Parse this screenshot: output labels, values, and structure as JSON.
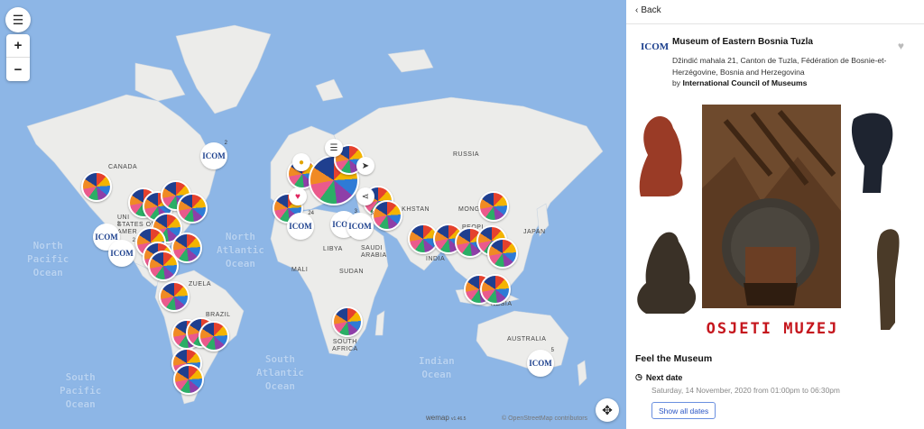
{
  "map": {
    "menu_icon": "hamburger-icon",
    "zoom_in": "+",
    "zoom_out": "−",
    "locate_icon": "crosshair-icon",
    "wemap_brand": "wemap",
    "wemap_version": "v1.46.5",
    "attribution": "© OpenStreetMap contributors",
    "place_labels": {
      "canada": "CANADA",
      "united_states": "UNI\nSTATES OF\nAMER",
      "russia": "RUSSIA",
      "mongolia": "MONGO",
      "kazakhstan": "AKHSTAN",
      "people": "PEOPL",
      "japan": "JAPAN",
      "libya": "LIBYA",
      "saudi": "SAUDI\nARABIA",
      "india": "INDIA",
      "mali": "MALI",
      "sudan": "SUDAN",
      "venezuela": "ZUELA",
      "brazil": "BRAZIL",
      "indonesia": "NESIA",
      "south_africa": "SOUTH\nAFRICA",
      "australia": "AUSTRALIA"
    },
    "oceans": {
      "north_pacific": "North\nPacific\nOcean",
      "north_atlantic": "North\nAtlantic\nOcean",
      "south_atlantic": "South\nAtlantic\nOcean",
      "indian": "Indian\nOcean",
      "south_pacific": "South\nPacific\nOcean"
    },
    "icom_label": "ICOM",
    "cluster_counts": [
      "2",
      "2",
      "2",
      "3",
      "24",
      "3",
      "5",
      "3"
    ],
    "accent": "#2e7bd6"
  },
  "panel": {
    "back_label": "Back",
    "logo": "ICOM",
    "title": "Museum of Eastern Bosnia Tuzla",
    "address": "Džindić mahala 21, Canton de Tuzla, Fédération de Bosnie-et-Herzégovine, Bosnia and Herzegovina",
    "by_prefix": "by ",
    "by_org": "International Council of Museums",
    "poster_text": "OSJETI MUZEJ",
    "section_title": "Feel the Museum",
    "next_date_label": "Next date",
    "next_date_value": "Saturday, 14 November, 2020 from 01:00pm to 06:30pm",
    "show_dates_button": "Show all dates",
    "colors": {
      "link": "#2a55c5",
      "poster_red": "#c5161d"
    }
  }
}
